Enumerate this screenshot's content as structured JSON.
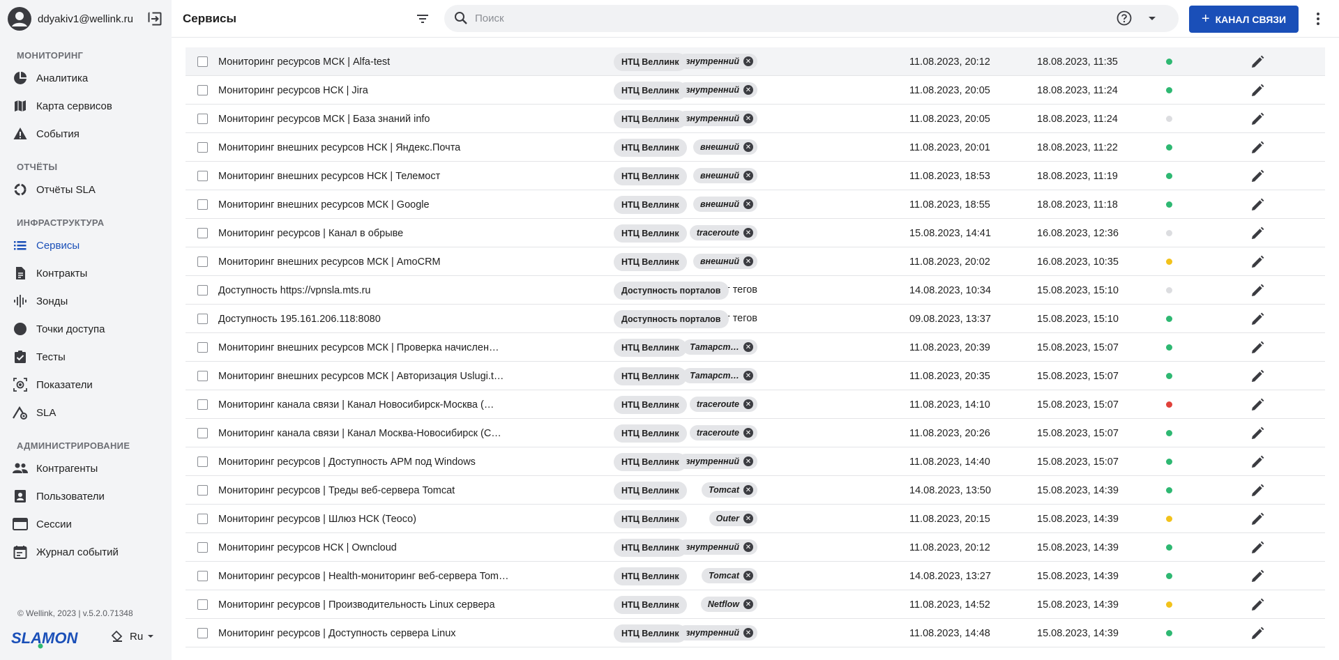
{
  "user": {
    "email": "ddyakiv1@wellink.ru"
  },
  "sidebar": {
    "sections": [
      {
        "title": "МОНИТОРИНГ",
        "items": [
          {
            "label": "Аналитика",
            "icon": "pie-chart-icon"
          },
          {
            "label": "Карта сервисов",
            "icon": "map-icon"
          },
          {
            "label": "События",
            "icon": "warning-icon"
          }
        ]
      },
      {
        "title": "ОТЧЁТЫ",
        "items": [
          {
            "label": "Отчёты SLA",
            "icon": "donut-icon"
          }
        ]
      },
      {
        "title": "ИНФРАСТРУКТУРА",
        "items": [
          {
            "label": "Сервисы",
            "icon": "list-icon",
            "active": true
          },
          {
            "label": "Контракты",
            "icon": "document-icon"
          },
          {
            "label": "Зонды",
            "icon": "waveform-icon"
          },
          {
            "label": "Точки доступа",
            "icon": "circle-icon"
          },
          {
            "label": "Тесты",
            "icon": "clipboard-check-icon"
          },
          {
            "label": "Показатели",
            "icon": "metrics-icon"
          },
          {
            "label": "SLA",
            "icon": "sla-icon"
          }
        ]
      },
      {
        "title": "АДМИНИСТРИРОВАНИЕ",
        "items": [
          {
            "label": "Контрагенты",
            "icon": "people-icon"
          },
          {
            "label": "Пользователи",
            "icon": "contact-card-icon"
          },
          {
            "label": "Сессии",
            "icon": "window-icon"
          },
          {
            "label": "Журнал событий",
            "icon": "calendar-icon"
          }
        ]
      }
    ],
    "copyright": "© Wellink, 2023 | v.5.2.0.71348",
    "logo_text": "SLAMON",
    "language": "Ru"
  },
  "header": {
    "title": "Сервисы",
    "search_placeholder": "Поиск",
    "primary_button": "КАНАЛ СВЯЗИ"
  },
  "colors": {
    "accent": "#1a4fb8",
    "green": "#2eb872",
    "grey": "#dcdde0",
    "yellow": "#f2c21b",
    "red": "#e0413a"
  },
  "rows": [
    {
      "name": "Мониторинг ресурсов МСК | Alfa-test",
      "tag": "внутренний",
      "contract": "НТЦ Веллинк",
      "created": "11.08.2023, 20:12",
      "updated": "18.08.2023, 11:35",
      "status": "green"
    },
    {
      "name": "Мониторинг ресурсов НСК | Jira",
      "tag": "внутренний",
      "contract": "НТЦ Веллинк",
      "created": "11.08.2023, 20:05",
      "updated": "18.08.2023, 11:24",
      "status": "green"
    },
    {
      "name": "Мониторинг ресурсов МСК | База знаний info",
      "tag": "внутренний",
      "contract": "НТЦ Веллинк",
      "created": "11.08.2023, 20:05",
      "updated": "18.08.2023, 11:24",
      "status": "grey"
    },
    {
      "name": "Мониторинг внешних ресурсов НСК | Яндекс.Почта",
      "tag": "внешний",
      "contract": "НТЦ Веллинк",
      "created": "11.08.2023, 20:01",
      "updated": "18.08.2023, 11:22",
      "status": "green"
    },
    {
      "name": "Мониторинг внешних ресурсов НСК | Телемост",
      "tag": "внешний",
      "contract": "НТЦ Веллинк",
      "created": "11.08.2023, 18:53",
      "updated": "18.08.2023, 11:19",
      "status": "green"
    },
    {
      "name": "Мониторинг внешних ресурсов МСК | Google",
      "tag": "внешний",
      "contract": "НТЦ Веллинк",
      "created": "11.08.2023, 18:55",
      "updated": "18.08.2023, 11:18",
      "status": "green"
    },
    {
      "name": "Мониторинг ресурсов | Канал в обрыве",
      "tag": "traceroute",
      "contract": "НТЦ Веллинк",
      "created": "15.08.2023, 14:41",
      "updated": "16.08.2023, 12:36",
      "status": "grey"
    },
    {
      "name": "Мониторинг внешних ресурсов МСК | AmoCRM",
      "tag": "внешний",
      "contract": "НТЦ Веллинк",
      "created": "11.08.2023, 20:02",
      "updated": "16.08.2023, 10:35",
      "status": "yellow"
    },
    {
      "name": "Доступность https://vpnsla.mts.ru",
      "tag": "",
      "notag": "Нет тегов",
      "contract": "Доступность порталов",
      "created": "14.08.2023, 10:34",
      "updated": "15.08.2023, 15:10",
      "status": "grey"
    },
    {
      "name": "Доступность 195.161.206.118:8080",
      "tag": "",
      "notag": "Нет тегов",
      "contract": "Доступность порталов",
      "created": "09.08.2023, 13:37",
      "updated": "15.08.2023, 15:10",
      "status": "green"
    },
    {
      "name": "Мониторинг внешних ресурсов МСК | Проверка начислен…",
      "tag": "Татарст…",
      "contract": "НТЦ Веллинк",
      "created": "11.08.2023, 20:39",
      "updated": "15.08.2023, 15:07",
      "status": "green"
    },
    {
      "name": "Мониторинг внешних ресурсов МСК | Авторизация Uslugi.t…",
      "tag": "Татарст…",
      "contract": "НТЦ Веллинк",
      "created": "11.08.2023, 20:35",
      "updated": "15.08.2023, 15:07",
      "status": "green"
    },
    {
      "name": "Мониторинг канала связи | Канал Новосибирск-Москва (…",
      "tag": "traceroute",
      "contract": "НТЦ Веллинк",
      "created": "11.08.2023, 14:10",
      "updated": "15.08.2023, 15:07",
      "status": "red"
    },
    {
      "name": "Мониторинг канала связи | Канал Москва-Новосибирск (С…",
      "tag": "traceroute",
      "contract": "НТЦ Веллинк",
      "created": "11.08.2023, 20:26",
      "updated": "15.08.2023, 15:07",
      "status": "green"
    },
    {
      "name": "Мониторинг ресурсов | Доступность АРМ под Windows",
      "tag": "внутренний",
      "contract": "НТЦ Веллинк",
      "created": "11.08.2023, 14:40",
      "updated": "15.08.2023, 15:07",
      "status": "green"
    },
    {
      "name": "Мониторинг ресурсов | Треды веб-сервера Tomcat",
      "tag": "Tomcat",
      "contract": "НТЦ Веллинк",
      "created": "14.08.2023, 13:50",
      "updated": "15.08.2023, 14:39",
      "status": "green"
    },
    {
      "name": "Мониторинг ресурсов | Шлюз НСК (Теосо)",
      "tag": "Outer",
      "contract": "НТЦ Веллинк",
      "created": "11.08.2023, 20:15",
      "updated": "15.08.2023, 14:39",
      "status": "yellow"
    },
    {
      "name": "Мониторинг ресурсов НСК | Owncloud",
      "tag": "внутренний",
      "contract": "НТЦ Веллинк",
      "created": "11.08.2023, 20:12",
      "updated": "15.08.2023, 14:39",
      "status": "green"
    },
    {
      "name": "Мониторинг ресурсов | Health-мониторинг веб-сервера Tom…",
      "tag": "Tomcat",
      "contract": "НТЦ Веллинк",
      "created": "14.08.2023, 13:27",
      "updated": "15.08.2023, 14:39",
      "status": "green"
    },
    {
      "name": "Мониторинг ресурсов | Производительность Linux сервера",
      "tag": "Netflow",
      "contract": "НТЦ Веллинк",
      "created": "11.08.2023, 14:52",
      "updated": "15.08.2023, 14:39",
      "status": "yellow"
    },
    {
      "name": "Мониторинг ресурсов | Доступность сервера Linux",
      "tag": "внутренний",
      "contract": "НТЦ Веллинк",
      "created": "11.08.2023, 14:48",
      "updated": "15.08.2023, 14:39",
      "status": "green"
    }
  ]
}
